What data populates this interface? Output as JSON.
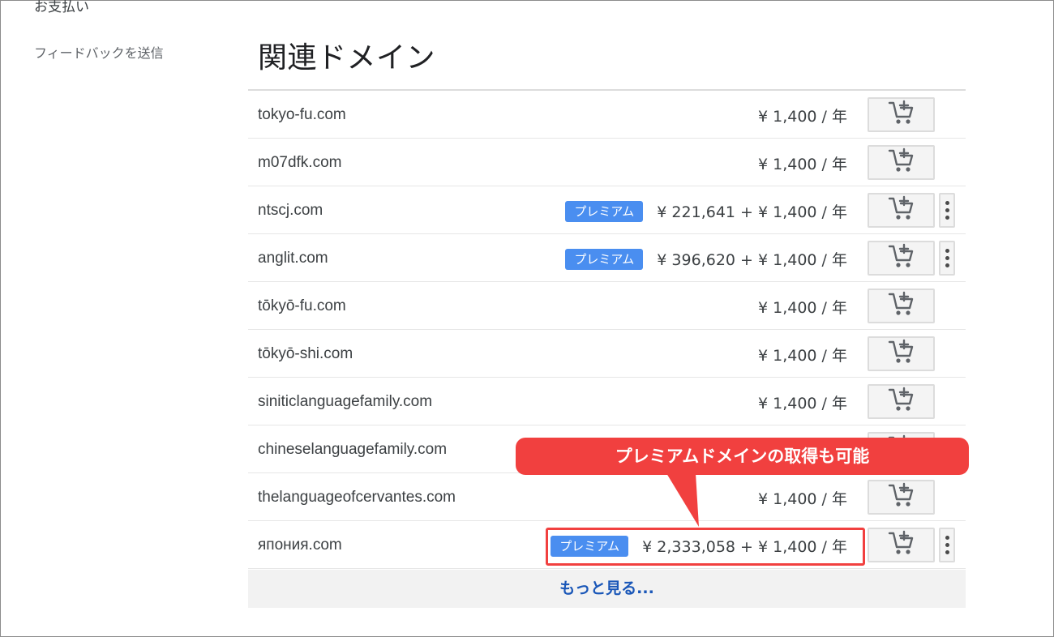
{
  "sidebar": {
    "payment_label": "お支払い",
    "feedback_label": "フィードバックを送信"
  },
  "main": {
    "title": "関連ドメイン",
    "rows": [
      {
        "domain": "tokyo-fu.com",
        "premium": false,
        "premium_label": "",
        "price": "¥ 1,400 / 年"
      },
      {
        "domain": "m07dfk.com",
        "premium": false,
        "premium_label": "",
        "price": "¥ 1,400 / 年"
      },
      {
        "domain": "ntscj.com",
        "premium": true,
        "premium_label": "プレミアム",
        "price": "¥ 221,641 +  ¥ 1,400 / 年"
      },
      {
        "domain": "anglit.com",
        "premium": true,
        "premium_label": "プレミアム",
        "price": "¥ 396,620 +  ¥ 1,400 / 年"
      },
      {
        "domain": "tōkyō-fu.com",
        "premium": false,
        "premium_label": "",
        "price": "¥ 1,400 / 年"
      },
      {
        "domain": "tōkyō-shi.com",
        "premium": false,
        "premium_label": "",
        "price": "¥ 1,400 / 年"
      },
      {
        "domain": "siniticlanguagefamily.com",
        "premium": false,
        "premium_label": "",
        "price": "¥ 1,400 / 年"
      },
      {
        "domain": "chineselanguagefamily.com",
        "premium": false,
        "premium_label": "",
        "price": ""
      },
      {
        "domain": "thelanguageofcervantes.com",
        "premium": false,
        "premium_label": "",
        "price": "¥ 1,400 / 年"
      },
      {
        "domain": "япония.com",
        "premium": true,
        "premium_label": "プレミアム",
        "price": "¥ 2,333,058 +  ¥ 1,400 / 年"
      }
    ],
    "show_more_label": "もっと見る..."
  },
  "annotation": {
    "callout_text": "プレミアムドメインの取得も可能",
    "color": "#f1403f"
  },
  "icons": {
    "cart": "add-to-cart-icon",
    "more": "more-vertical-icon"
  },
  "colors": {
    "premium_badge": "#4a8ef0",
    "link": "#1a57b8"
  }
}
